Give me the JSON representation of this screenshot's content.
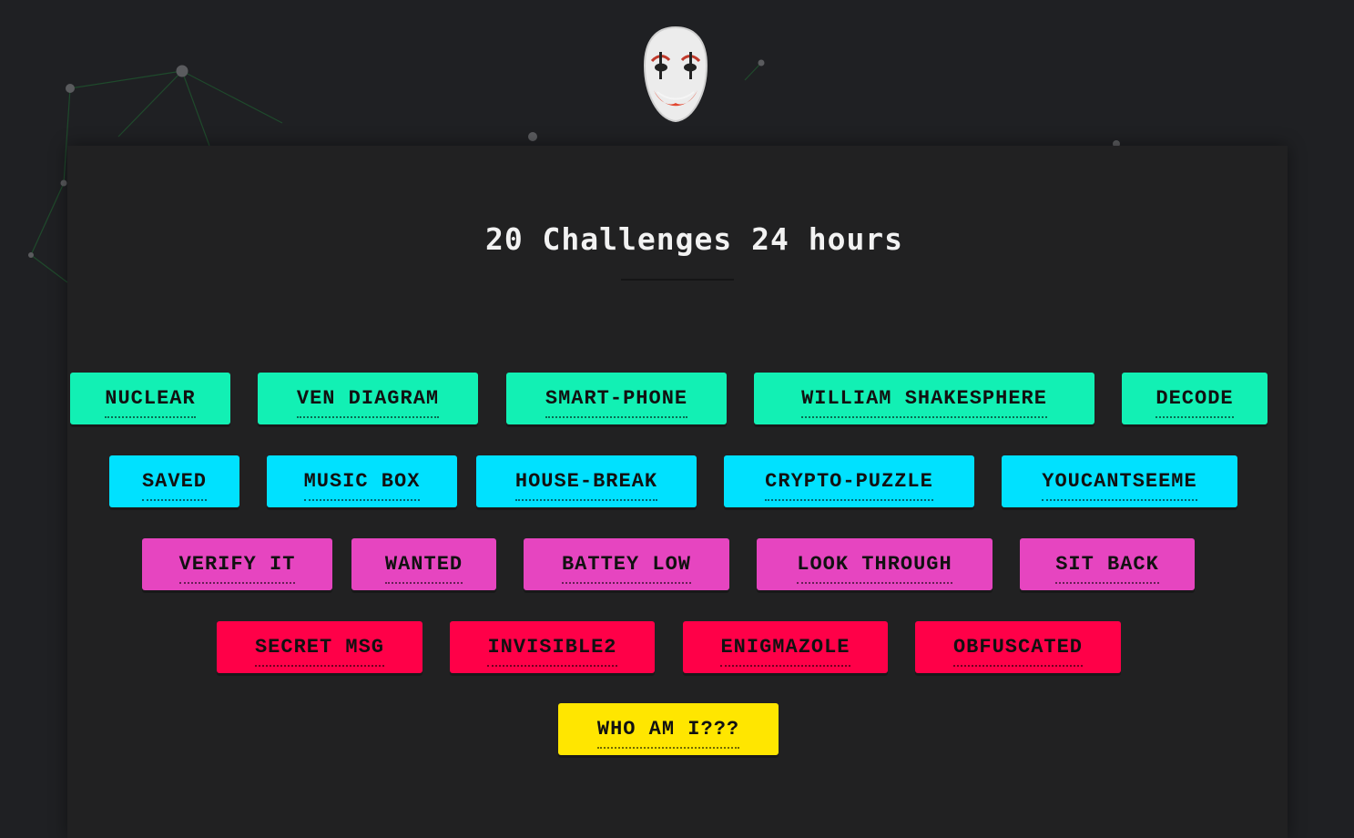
{
  "header": {
    "title": "20 Challenges 24 hours",
    "logo_icon": "clown-mask-icon"
  },
  "colors": {
    "background": "#1f2023",
    "panel": "#212122",
    "green": "#12f0b4",
    "cyan": "#00e1ff",
    "pink": "#e645c0",
    "red": "#ff0048",
    "yellow": "#ffe600"
  },
  "challenges": [
    {
      "label": "NUCLEAR",
      "color": "green"
    },
    {
      "label": "VEN DIAGRAM",
      "color": "green"
    },
    {
      "label": "SMART-PHONE",
      "color": "green"
    },
    {
      "label": "WILLIAM SHAKESPHERE",
      "color": "green"
    },
    {
      "label": "DECODE",
      "color": "green"
    },
    {
      "label": "SAVED",
      "color": "cyan"
    },
    {
      "label": "MUSIC BOX",
      "color": "cyan"
    },
    {
      "label": "HOUSE-BREAK",
      "color": "cyan"
    },
    {
      "label": "CRYPTO-PUZZLE",
      "color": "cyan"
    },
    {
      "label": "YOUCANTSEEME",
      "color": "cyan"
    },
    {
      "label": "VERIFY IT",
      "color": "pink"
    },
    {
      "label": "WANTED",
      "color": "pink"
    },
    {
      "label": "BATTEY LOW",
      "color": "pink"
    },
    {
      "label": "LOOK THROUGH",
      "color": "pink"
    },
    {
      "label": "SIT BACK",
      "color": "pink"
    },
    {
      "label": "SECRET MSG",
      "color": "red"
    },
    {
      "label": "INVISIBLE2",
      "color": "red"
    },
    {
      "label": "ENIGMAZOLE",
      "color": "red"
    },
    {
      "label": "OBFUSCATED",
      "color": "red"
    },
    {
      "label": "WHO AM I???",
      "color": "yellow"
    }
  ]
}
